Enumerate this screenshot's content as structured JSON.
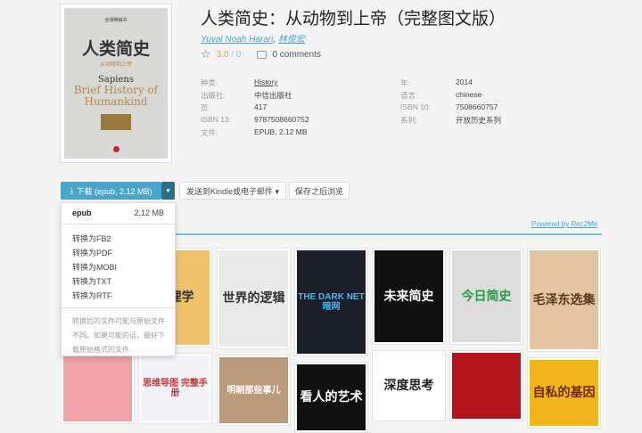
{
  "book": {
    "cover_text": {
      "series": "全球畅销书",
      "title_cn": "人类简史",
      "subtitle_cn": "从动物到上帝",
      "sapiens": "Sapiens",
      "title_en": "Brief History of Humankind"
    },
    "title": "人类简史：从动物到上帝（完整图文版）",
    "authors": [
      "Yuval Noah Harari",
      "林俊宏"
    ],
    "rating": "3.0",
    "rating_sep": "/",
    "rating_count": "0",
    "comments": "0 comments",
    "props_left": [
      {
        "k": "种类:",
        "v": "History"
      },
      {
        "k": "出版社:",
        "v": "中信出版社"
      },
      {
        "k": "页:",
        "v": "417"
      },
      {
        "k": "ISBN 13:",
        "v": "9787508660752"
      },
      {
        "k": "文件:",
        "v": "EPUB, 2.12 MB"
      }
    ],
    "props_right": [
      {
        "k": "年:",
        "v": "2014"
      },
      {
        "k": "语言:",
        "v": "chinese"
      },
      {
        "k": "ISBN 10:",
        "v": "7508660757"
      },
      {
        "k": "系列:",
        "v": "开放历史系列"
      }
    ]
  },
  "actions": {
    "download": "下载 (epub, 2.12 MB)",
    "kindle": "发送到Kindle或电子邮件 ▾",
    "save": "保存之后浏览"
  },
  "menu": {
    "format": "epub",
    "size": "2.12 MB",
    "convert": [
      "转换为FB2",
      "转换为PDF",
      "转换为MOBI",
      "转换为TXT",
      "转换为RTF"
    ],
    "note": "转换后的文件可能与原始文件不同。如果可能的话，最好下载原始格式的文件."
  },
  "recs": {
    "powered": "Powered by Rec2Me",
    "covers": [
      {
        "text": "",
        "bg": "#e8a25b",
        "fg": "#fff"
      },
      {
        "text": "心理学",
        "bg": "#f0c36a",
        "fg": "#333"
      },
      {
        "text": "世界的逻辑",
        "bg": "#e9e9e9",
        "fg": "#333"
      },
      {
        "text": "THE DARK NET 暗网",
        "bg": "#1b1f2a",
        "fg": "#4fb3e8"
      },
      {
        "text": "未来简史",
        "bg": "#111",
        "fg": "#fff"
      },
      {
        "text": "今日简史",
        "bg": "#dcdcdc",
        "fg": "#2a9a4a"
      },
      {
        "text": "毛泽东选集",
        "bg": "#e2c4a0",
        "fg": "#5a3a20"
      },
      {
        "text": "",
        "bg": "#f2a3a6",
        "fg": "#333"
      },
      {
        "text": "思维导图 完整手册",
        "bg": "#f4f4f8",
        "fg": "#c33"
      },
      {
        "text": "",
        "bg": "#c9a37a",
        "fg": "#333"
      },
      {
        "text": "明朝那些事儿",
        "bg": "#b99a7a",
        "fg": "#fff"
      },
      {
        "text": "看人的艺术",
        "bg": "#111",
        "fg": "#fff"
      },
      {
        "text": "深度思考",
        "bg": "#fff",
        "fg": "#222"
      },
      {
        "text": "",
        "bg": "#b3141b",
        "fg": "#333"
      },
      {
        "text": "自私的基因",
        "bg": "#f2b51c",
        "fg": "#6b2b0b"
      }
    ]
  }
}
